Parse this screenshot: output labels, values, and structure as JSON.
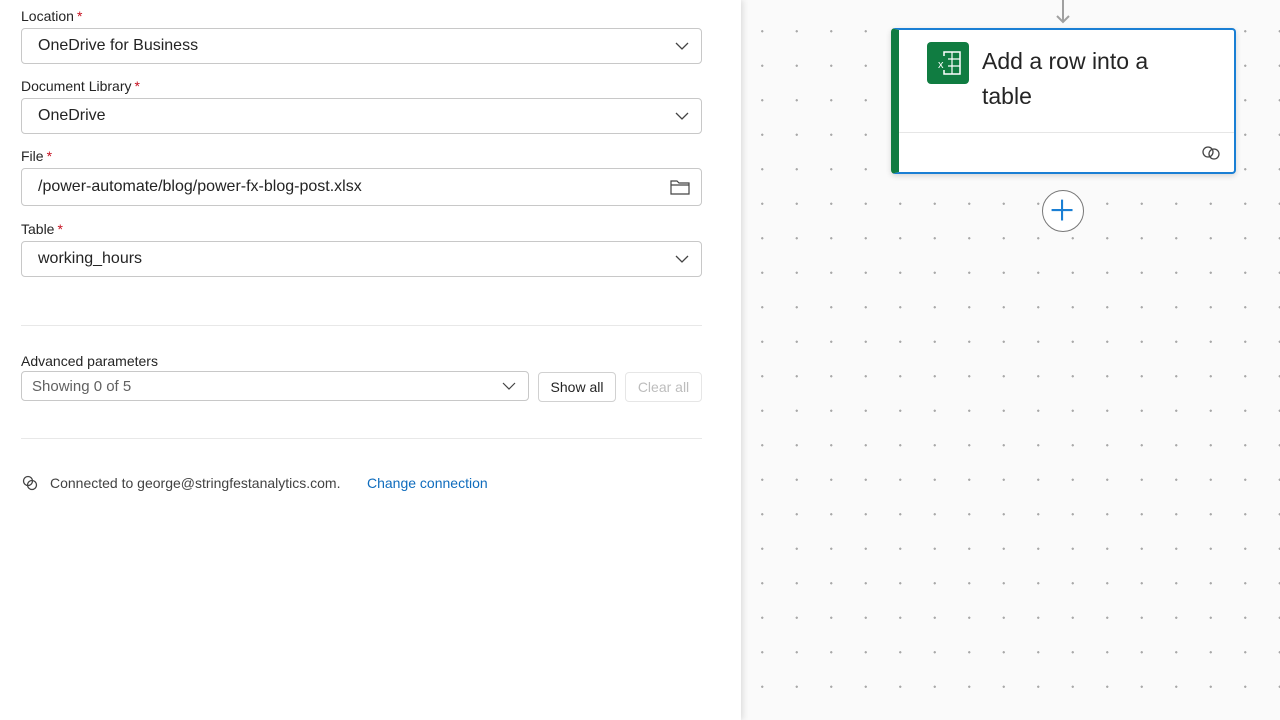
{
  "form": {
    "location": {
      "label": "Location",
      "required": "*",
      "value": "OneDrive for Business"
    },
    "library": {
      "label": "Document Library",
      "required": "*",
      "value": "OneDrive"
    },
    "file": {
      "label": "File",
      "required": "*",
      "value": "/power-automate/blog/power-fx-blog-post.xlsx"
    },
    "table": {
      "label": "Table",
      "required": "*",
      "value": "working_hours"
    },
    "advanced": {
      "label": "Advanced parameters",
      "value": "Showing 0 of 5",
      "show_all": "Show all",
      "clear_all": "Clear all"
    },
    "connection": {
      "text": "Connected to george@stringfestanalytics.com.",
      "change": "Change connection"
    }
  },
  "canvas": {
    "card_title": "Add a row into a table",
    "accent": "#107c41",
    "selected_border": "#1a7fd4"
  }
}
